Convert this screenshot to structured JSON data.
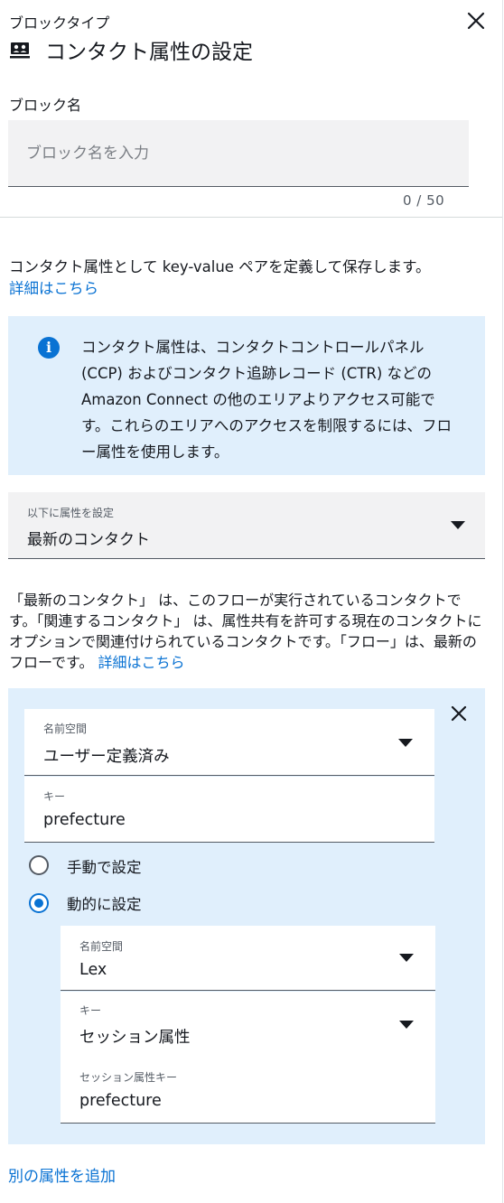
{
  "header": {
    "block_type_label": "ブロックタイプ",
    "title": "コンタクト属性の設定",
    "title_icon": "contact-card-icon",
    "close_icon": "close-icon"
  },
  "block_name": {
    "label": "ブロック名",
    "placeholder": "ブロック名を入力",
    "value": "",
    "counter": "0 / 50"
  },
  "description": {
    "text": "コンタクト属性として key-value ペアを定義して保存します。",
    "link": "詳細はこちら"
  },
  "info": {
    "icon": "info-icon",
    "text": "コンタクト属性は、コンタクトコントロールパネル (CCP) およびコンタクト追跡レコード (CTR) などの Amazon Connect の他のエリアよりアクセス可能です。これらのエリアへのアクセスを制限するには、フロー属性を使用します。"
  },
  "set_attributes_on": {
    "label": "以下に属性を設定",
    "value": "最新のコンタクト"
  },
  "explanation": {
    "text": "「最新のコンタクト」 は、このフローが実行されているコンタクトです。「関連するコンタクト」 は、属性共有を許可する現在のコンタクトにオプションで関連付けられているコンタクトです。「フロー」は、最新のフローです。",
    "link": "詳細はこちら"
  },
  "attribute": {
    "namespace": {
      "label": "名前空間",
      "value": "ユーザー定義済み"
    },
    "key": {
      "label": "キー",
      "value": "prefecture"
    },
    "manual_label": "手動で設定",
    "dynamic_label": "動的に設定",
    "selected_mode": "dynamic",
    "dynamic": {
      "namespace": {
        "label": "名前空間",
        "value": "Lex"
      },
      "key": {
        "label": "キー",
        "value": "セッション属性"
      },
      "session_key": {
        "label": "セッション属性キー",
        "value": "prefecture"
      }
    }
  },
  "add_attribute_link": "別の属性を追加",
  "colors": {
    "accent": "#0972d3",
    "info_bg": "#e0effc",
    "field_bg": "#f2f2f3",
    "text": "#16191f"
  }
}
